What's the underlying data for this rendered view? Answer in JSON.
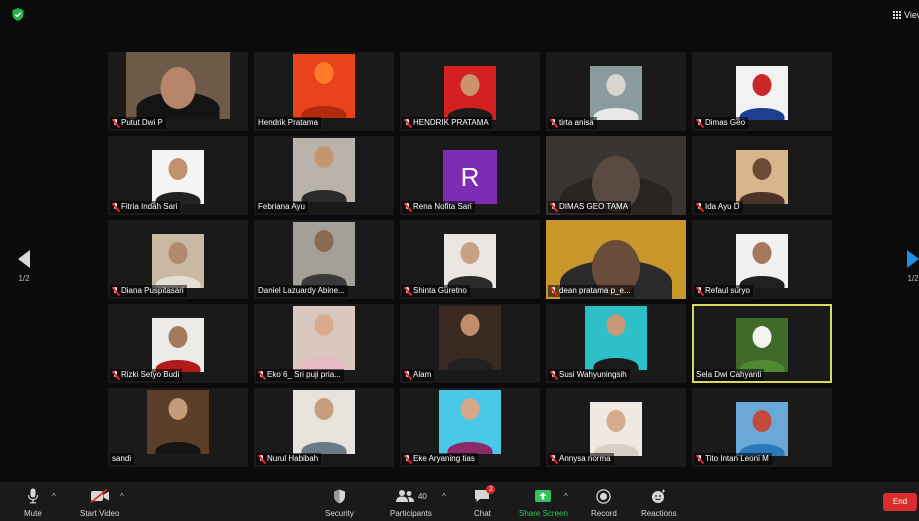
{
  "top_bar": {
    "view_label": "View"
  },
  "navigation": {
    "left_page": "1/2",
    "right_page": "1/2"
  },
  "participants": [
    {
      "name": "Putut Dwi P",
      "muted": true,
      "bg": "#6e5a48",
      "skin": "#b7866a",
      "shirt": "#141414"
    },
    {
      "name": "Hendrik Pratama",
      "muted": false,
      "bg": "#e8431a",
      "skin": "#ff7a2a",
      "shirt": "#b32a0c"
    },
    {
      "name": "HENDRIK PRATAMA",
      "muted": true,
      "bg": "#d42020",
      "skin": "#c9936e",
      "shirt": "#1b1b1b"
    },
    {
      "name": "tirta anisa",
      "muted": true,
      "bg": "#8a9ba0",
      "skin": "#d9d6d2",
      "shirt": "#e8e8e8"
    },
    {
      "name": "Dimas Geo",
      "muted": true,
      "bg": "#f2f2f2",
      "skin": "#c82828",
      "shirt": "#1d3f8f"
    },
    {
      "name": "Fitria Indah Sari",
      "muted": true,
      "bg": "#f4f4f4",
      "skin": "#c09070",
      "shirt": "#222222"
    },
    {
      "name": "Febriana Ayu",
      "muted": false,
      "bg": "#b9b3ab",
      "skin": "#c4956e",
      "shirt": "#2b2b2b"
    },
    {
      "name": "Rena Nofita Sari",
      "muted": true,
      "letter": "R"
    },
    {
      "name": "DIMAS GEO TAMA",
      "muted": true,
      "bg": "#3a3532",
      "skin": "#5a4a42",
      "shirt": "#2a2522"
    },
    {
      "name": "Ida Ayu D",
      "muted": true,
      "bg": "#d9b58c",
      "skin": "#6b4a36",
      "shirt": "#4a3328"
    },
    {
      "name": "Diana Puspitasari",
      "muted": true,
      "bg": "#c9b9a2",
      "skin": "#b08a6c",
      "shirt": "#e6ded2"
    },
    {
      "name": "Daniel Lazuardy Abine...",
      "muted": false,
      "bg": "#a5a097",
      "skin": "#8a6a50",
      "shirt": "#3a3a3a"
    },
    {
      "name": "Shinta Guretno",
      "muted": true,
      "bg": "#e9e6e2",
      "skin": "#c8a184",
      "shirt": "#2a2a2a"
    },
    {
      "name": "dean pratama p_e...",
      "muted": true,
      "bg": "#c8962a",
      "skin": "#6a4c3a",
      "shirt": "#2a2a2a"
    },
    {
      "name": "Refaul suryo",
      "muted": true,
      "bg": "#f1f1f1",
      "skin": "#a57a5c",
      "shirt": "#202020"
    },
    {
      "name": "Rizki Setyo Budi",
      "muted": true,
      "bg": "#ecebe8",
      "skin": "#a57a5c",
      "shirt": "#b01c1c"
    },
    {
      "name": "Eko 6_ Sri puji pria...",
      "muted": true,
      "bg": "#d9c7c0",
      "skin": "#d8ab8e",
      "shirt": "#e7b9c2"
    },
    {
      "name": "Alam",
      "muted": true,
      "bg": "#3a2a22",
      "skin": "#c08e6a",
      "shirt": "#202020"
    },
    {
      "name": "Susi Wahyuningsih",
      "muted": true,
      "bg": "#2ec0c8",
      "skin": "#c7987a",
      "shirt": "#1b1b1b"
    },
    {
      "name": "Sela Dwi Cahyanti",
      "muted": false,
      "active": true,
      "bg": "#3f6a2a",
      "skin": "#f3f3f0",
      "shirt": "#4f8a33"
    },
    {
      "name": "sandi",
      "muted": false,
      "bg": "#5a3e2a",
      "skin": "#c49a78",
      "shirt": "#151515"
    },
    {
      "name": "Nurul Habibah",
      "muted": true,
      "bg": "#e7e3dc",
      "skin": "#c69c7c",
      "shirt": "#6a7a86"
    },
    {
      "name": "Eke Aryaning tias",
      "muted": true,
      "bg": "#4ac8e8",
      "skin": "#d6a888",
      "shirt": "#8a2a6a"
    },
    {
      "name": "Annysa norma",
      "muted": true,
      "bg": "#efe9e2",
      "skin": "#d4ab8c",
      "shirt": "#d9cfc4"
    },
    {
      "name": "Tito Intan Leoni M",
      "muted": true,
      "bg": "#6aa8d8",
      "skin": "#c24a3a",
      "shirt": "#2a78b8"
    }
  ],
  "toolbar": {
    "mute": "Mute",
    "start_video": "Start Video",
    "security": "Security",
    "participants": "Participants",
    "participant_count": "40",
    "chat": "Chat",
    "chat_badge": "2",
    "share_screen": "Share Screen",
    "record": "Record",
    "reactions": "Reactions",
    "end": "End"
  },
  "colors": {
    "background": "#0b0b0b",
    "toolbar": "#1a1a1a",
    "active_speaker": "#d3dc5e",
    "share_green": "#2fc45a",
    "end_red": "#d92c2c",
    "muted_red": "#e02828",
    "next_arrow": "#1c8ee6"
  }
}
